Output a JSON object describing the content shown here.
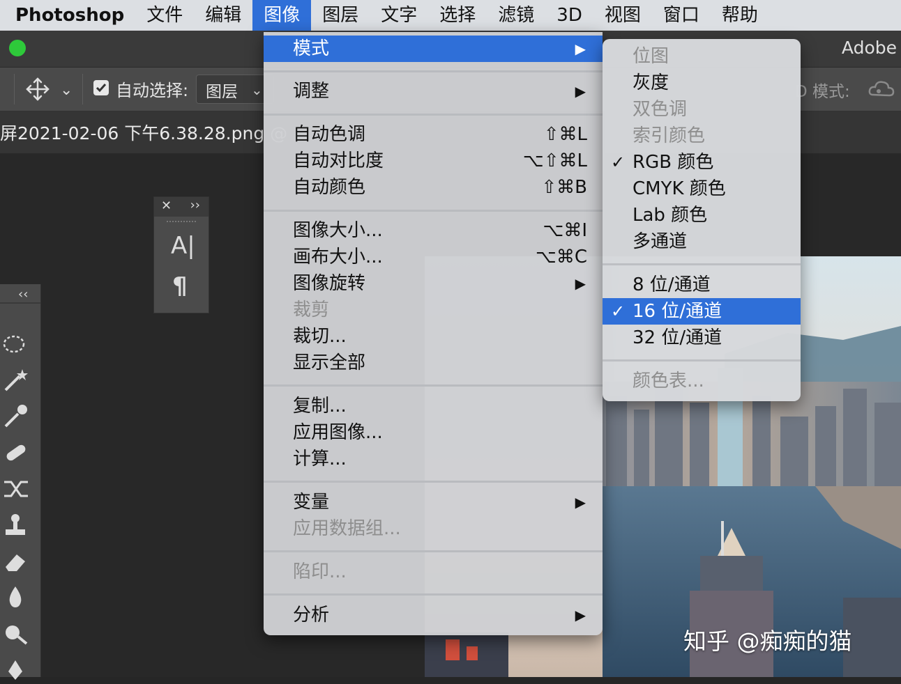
{
  "menubar": {
    "app": "Photoshop",
    "items": [
      "文件",
      "编辑",
      "图像",
      "图层",
      "文字",
      "选择",
      "滤镜",
      "3D",
      "视图",
      "窗口",
      "帮助"
    ],
    "active_index": 2
  },
  "titlebar": {
    "right_text": "Adobe"
  },
  "options": {
    "auto_select_label": "自动选择:",
    "layer_select_value": "图层",
    "mode3d_label": "D 模式:"
  },
  "document": {
    "tab_title": "屏2021-02-06 下午6.38.28.png @"
  },
  "menu": {
    "items": [
      {
        "label": "模式",
        "arrow": "▶",
        "highlighted": true
      },
      {
        "label": "调整",
        "arrow": "▶"
      },
      {
        "label": "自动色调",
        "shortcut": "⇧⌘L"
      },
      {
        "label": "自动对比度",
        "shortcut": "⌥⇧⌘L"
      },
      {
        "label": "自动颜色",
        "shortcut": "⇧⌘B"
      },
      {
        "label": "图像大小...",
        "shortcut": "⌥⌘I"
      },
      {
        "label": "画布大小...",
        "shortcut": "⌥⌘C"
      },
      {
        "label": "图像旋转",
        "arrow": "▶"
      },
      {
        "label": "裁剪",
        "disabled": true
      },
      {
        "label": "裁切..."
      },
      {
        "label": "显示全部"
      },
      {
        "label": "复制..."
      },
      {
        "label": "应用图像..."
      },
      {
        "label": "计算..."
      },
      {
        "label": "变量",
        "arrow": "▶"
      },
      {
        "label": "应用数据组...",
        "disabled": true
      },
      {
        "label": "陷印...",
        "disabled": true
      },
      {
        "label": "分析",
        "arrow": "▶"
      }
    ]
  },
  "submenu": {
    "items": [
      {
        "label": "位图",
        "disabled": true
      },
      {
        "label": "灰度"
      },
      {
        "label": "双色调",
        "disabled": true
      },
      {
        "label": "索引颜色",
        "disabled": true
      },
      {
        "label": "RGB 颜色",
        "checked": true
      },
      {
        "label": "CMYK 颜色"
      },
      {
        "label": "Lab 颜色"
      },
      {
        "label": "多通道"
      },
      {
        "label": "8 位/通道"
      },
      {
        "label": "16 位/通道",
        "checked": true,
        "highlighted": true
      },
      {
        "label": "32 位/通道"
      },
      {
        "label": "颜色表...",
        "disabled": true
      }
    ]
  },
  "check_glyph": "✓",
  "watermark": "知乎 @痴痴的猫",
  "colors": {
    "accent": "#2f6fd8",
    "menubar_bg": "#dcdfe3",
    "app_bg": "#262626"
  }
}
